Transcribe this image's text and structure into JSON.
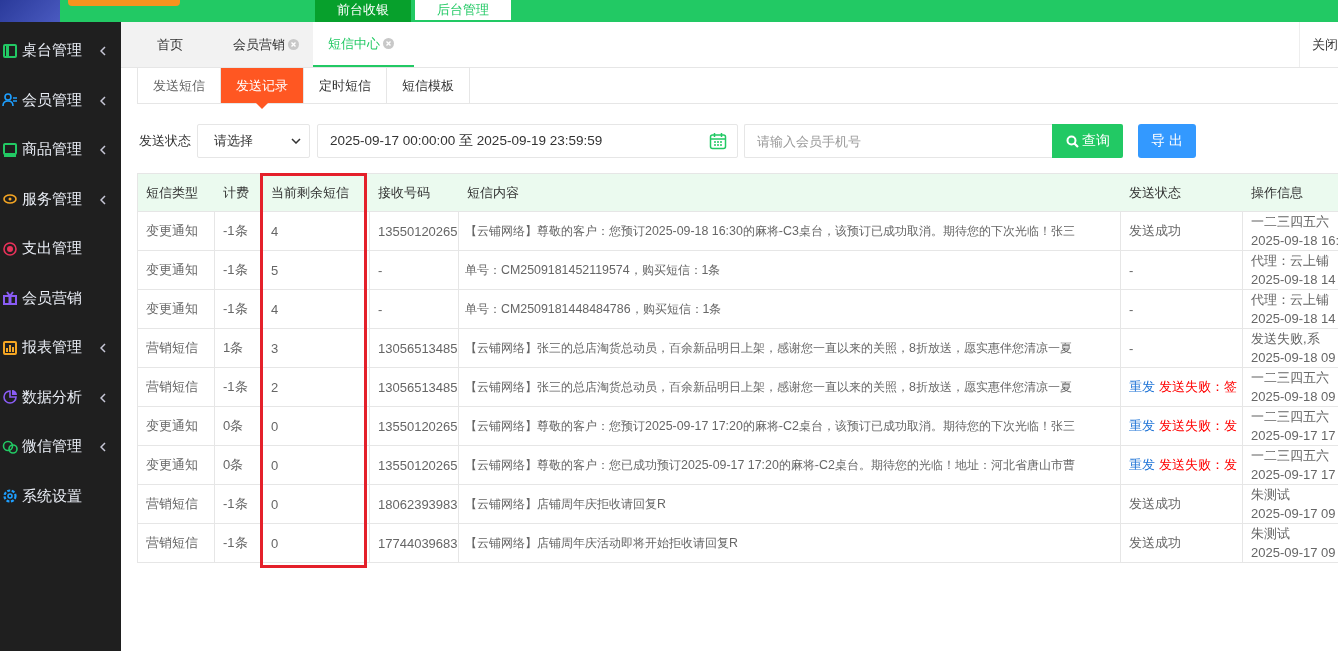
{
  "top_nav": [
    {
      "label": "前台收银",
      "selected": false
    },
    {
      "label": "后台管理",
      "selected": true
    }
  ],
  "sidebar": {
    "items": [
      {
        "label": "桌台管理",
        "color": "#22c964",
        "expandable": true
      },
      {
        "label": "会员管理",
        "color": "#1e9fff",
        "expandable": true
      },
      {
        "label": "商品管理",
        "color": "#22c964",
        "expandable": true
      },
      {
        "label": "服务管理",
        "color": "#f5a623",
        "expandable": true
      },
      {
        "label": "支出管理",
        "color": "#e8325a",
        "expandable": false
      },
      {
        "label": "会员营销",
        "color": "#8a5cf5",
        "expandable": false
      },
      {
        "label": "报表管理",
        "color": "#f5a623",
        "expandable": true
      },
      {
        "label": "数据分析",
        "color": "#8a5cf5",
        "expandable": true
      },
      {
        "label": "微信管理",
        "color": "#22c964",
        "expandable": true
      },
      {
        "label": "系统设置",
        "color": "#1e9fff",
        "expandable": false
      }
    ]
  },
  "page_tabs": {
    "tabs": [
      {
        "label": "首页",
        "selected": false,
        "closable": false
      },
      {
        "label": "会员营销",
        "selected": false,
        "closable": true
      },
      {
        "label": "短信中心",
        "selected": true,
        "closable": true
      }
    ],
    "close_label": "关闭"
  },
  "sub_tabs": [
    {
      "label": "发送短信",
      "selected": false
    },
    {
      "label": "发送记录",
      "selected": true
    },
    {
      "label": "定时短信",
      "selected": false
    },
    {
      "label": "短信模板",
      "selected": false
    }
  ],
  "filters": {
    "status_label": "发送状态",
    "status_select": "请选择",
    "date_range": "2025-09-17 00:00:00 至 2025-09-19 23:59:59",
    "phone": {
      "placeholder": "请输入会员手机号"
    },
    "search_button": "查询",
    "export_button": "导 出"
  },
  "table": {
    "columns": [
      {
        "label": "短信类型",
        "highlighted": false
      },
      {
        "label": "计费",
        "highlighted": false
      },
      {
        "label": "当前剩余短信",
        "highlighted": true
      },
      {
        "label": "接收号码",
        "highlighted": false
      },
      {
        "label": "短信内容",
        "highlighted": false
      },
      {
        "label": "发送状态",
        "highlighted": false
      },
      {
        "label": "操作信息",
        "highlighted": false
      }
    ],
    "rows": [
      {
        "type": "变更通知",
        "fee": "-1条",
        "remaining": "4",
        "phone": "13550120265",
        "content": "【云铺网络】尊敬的客户：您预订2025-09-18 16:30的麻将-C3桌台，该预订已成功取消。期待您的下次光临！张三",
        "status": {
          "kind": "success",
          "text": "发送成功"
        },
        "operator": "一二三四五六",
        "time": "2025-09-18 16:"
      },
      {
        "type": "变更通知",
        "fee": "-1条",
        "remaining": "5",
        "phone": "-",
        "content": "单号：CM2509181452119574，购买短信：1条",
        "status": {
          "kind": "none",
          "text": "-"
        },
        "operator": "代理：云上铺",
        "time": "2025-09-18 14"
      },
      {
        "type": "变更通知",
        "fee": "-1条",
        "remaining": "4",
        "phone": "-",
        "content": "单号：CM2509181448484786，购买短信：1条",
        "status": {
          "kind": "none",
          "text": "-"
        },
        "operator": "代理：云上铺",
        "time": "2025-09-18 14"
      },
      {
        "type": "营销短信",
        "fee": "1条",
        "remaining": "3",
        "phone": "13056513485",
        "content": "【云铺网络】张三的总店淘货总动员，百余新品明日上架，感谢您一直以来的关照，8折放送，愿实惠伴您清凉一夏",
        "status": {
          "kind": "none",
          "text": "-"
        },
        "operator": "发送失败,系",
        "time": "2025-09-18 09"
      },
      {
        "type": "营销短信",
        "fee": "-1条",
        "remaining": "2",
        "phone": "13056513485",
        "content": "【云铺网络】张三的总店淘货总动员，百余新品明日上架，感谢您一直以来的关照，8折放送，愿实惠伴您清凉一夏",
        "status": {
          "kind": "failed",
          "resend": "重发",
          "text": "发送失败：签"
        },
        "operator": "一二三四五六",
        "time": "2025-09-18 09"
      },
      {
        "type": "变更通知",
        "fee": "0条",
        "remaining": "0",
        "phone": "13550120265",
        "content": "【云铺网络】尊敬的客户：您预订2025-09-17 17:20的麻将-C2桌台，该预订已成功取消。期待您的下次光临！张三",
        "status": {
          "kind": "failed",
          "resend": "重发",
          "text": "发送失败：发"
        },
        "operator": "一二三四五六",
        "time": "2025-09-17 17"
      },
      {
        "type": "变更通知",
        "fee": "0条",
        "remaining": "0",
        "phone": "13550120265",
        "content": "【云铺网络】尊敬的客户：您已成功预订2025-09-17 17:20的麻将-C2桌台。期待您的光临！地址：河北省唐山市曹",
        "status": {
          "kind": "failed",
          "resend": "重发",
          "text": "发送失败：发"
        },
        "operator": "一二三四五六",
        "time": "2025-09-17 17"
      },
      {
        "type": "营销短信",
        "fee": "-1条",
        "remaining": "0",
        "phone": "18062393983",
        "content": "【云铺网络】店铺周年庆拒收请回复R",
        "status": {
          "kind": "success",
          "text": "发送成功"
        },
        "operator": "朱测试",
        "time": "2025-09-17 09"
      },
      {
        "type": "营销短信",
        "fee": "-1条",
        "remaining": "0",
        "phone": "17744039683",
        "content": "【云铺网络】店铺周年庆活动即将开始拒收请回复R",
        "status": {
          "kind": "success",
          "text": "发送成功"
        },
        "operator": "朱测试",
        "time": "2025-09-17 09"
      }
    ]
  }
}
